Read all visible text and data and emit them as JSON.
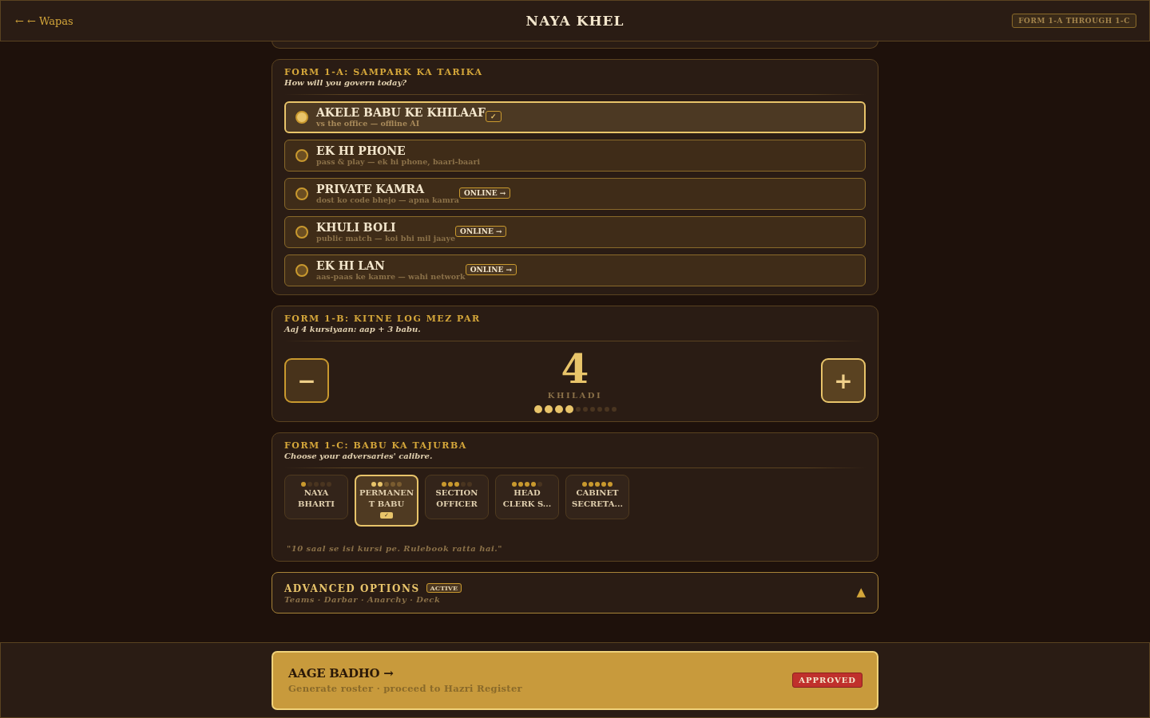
{
  "header": {
    "back": "← ← Wapas",
    "title": "NAYA KHEL",
    "badge": "FORM 1-A THROUGH 1-C"
  },
  "mode": {
    "title": "FORM 1-A: SAMPARK KA TARIKA",
    "subtitle": "How will you govern today?",
    "options": [
      {
        "title": "AKELE BABU KE KHILAAF",
        "subtitle": "vs the office — offline AI",
        "badge": "✓",
        "selected": true
      },
      {
        "title": "EK HI PHONE",
        "subtitle": "pass & play — ek hi phone, baari-baari",
        "selected": false
      },
      {
        "title": "PRIVATE KAMRA",
        "subtitle": "dost ko code bhejo — apna kamra",
        "badge": "ONLINE →",
        "selected": false
      },
      {
        "title": "KHULI BOLI",
        "subtitle": "public match — koi bhi mil jaaye",
        "badge": "ONLINE →",
        "selected": false
      },
      {
        "title": "EK HI LAN",
        "subtitle": "aas-paas ke kamre — wahi network",
        "badge": "ONLINE →",
        "selected": false
      }
    ]
  },
  "players": {
    "title": "FORM 1-B: KITNE LOG MEZ PAR",
    "subtitle": "Aaj 4 kursiyaan: aap + 3 babu.",
    "minus": "−",
    "count": "4",
    "unit": "KHILADI",
    "plus": "+",
    "seats": [
      {
        "on": true
      },
      {
        "on": true
      },
      {
        "on": true
      },
      {
        "on": true
      },
      {
        "on": false
      },
      {
        "on": false
      },
      {
        "on": false
      },
      {
        "on": false
      },
      {
        "on": false
      },
      {
        "on": false
      }
    ]
  },
  "difficulty": {
    "title": "FORM 1-C: BABU KA TAJURBA",
    "subtitle": "Choose your adversaries' calibre.",
    "levels": [
      {
        "label": "NAYA BHARTI",
        "stars": 1,
        "selected": false
      },
      {
        "label": "PERMANENT BABU",
        "stars": 2,
        "selected": true,
        "badge": "✓"
      },
      {
        "label": "SECTION OFFICER",
        "stars": 3,
        "selected": false
      },
      {
        "label": "HEAD CLERK S...",
        "stars": 4,
        "selected": false
      },
      {
        "label": "CABINET SECRETA...",
        "stars": 5,
        "selected": false
      }
    ],
    "quote": "\"10 saal se isi kursi pe. Rulebook ratta hai.\""
  },
  "advanced": {
    "title": "ADVANCED OPTIONS",
    "badge": "ACTIVE",
    "subtitle": "Teams · Darbar · Anarchy · Deck",
    "toggle": "▲"
  },
  "footer": {
    "title": "AAGE BADHO →",
    "subtitle": "Generate roster · proceed to Hazri Register",
    "status": "APPROVED"
  }
}
